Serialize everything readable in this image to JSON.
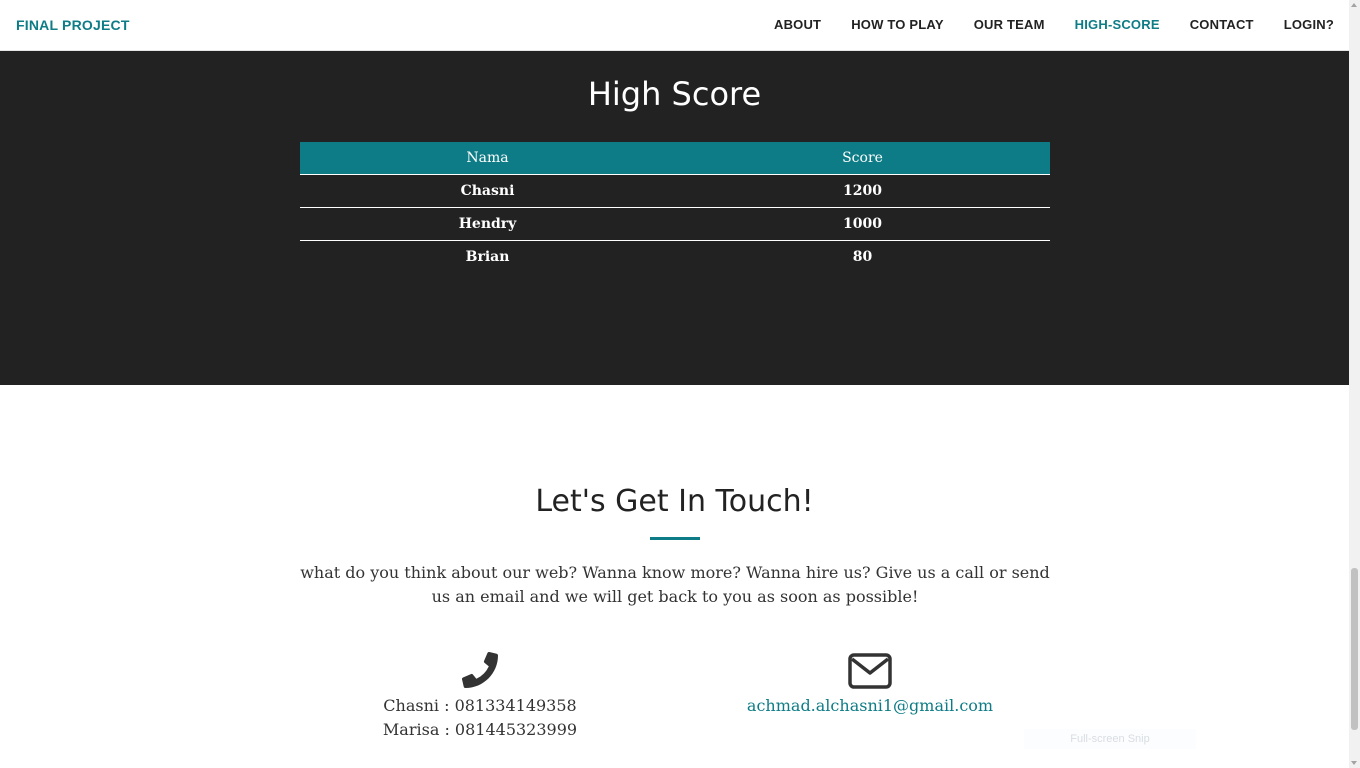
{
  "nav": {
    "brand": "FINAL PROJECT",
    "links": [
      "ABOUT",
      "HOW TO PLAY",
      "OUR TEAM",
      "HIGH-SCORE",
      "CONTACT",
      "LOGIN?"
    ],
    "active_link": "HIGH-SCORE"
  },
  "highscore": {
    "title": "High Score",
    "columns": [
      "Nama",
      "Score"
    ],
    "rows": [
      {
        "name": "Chasni",
        "score": "1200"
      },
      {
        "name": "Hendry",
        "score": "1000"
      },
      {
        "name": "Brian",
        "score": "80"
      }
    ]
  },
  "contact": {
    "title": "Let's Get In Touch!",
    "text": "what do you think about our web? Wanna know more? Wanna hire us? Give us a call or send us an email and we will get back to you as soon as possible!",
    "phone_icon": "phone-icon",
    "phones": [
      "Chasni : 081334149358",
      "Marisa : 081445323999"
    ],
    "email_icon": "envelope-icon",
    "email": "achmad.alchasni1@gmail.com"
  },
  "overlay": {
    "snip_label": "Full-screen Snip"
  },
  "colors": {
    "accent": "#0e7c86",
    "dark_bg": "#222222"
  }
}
